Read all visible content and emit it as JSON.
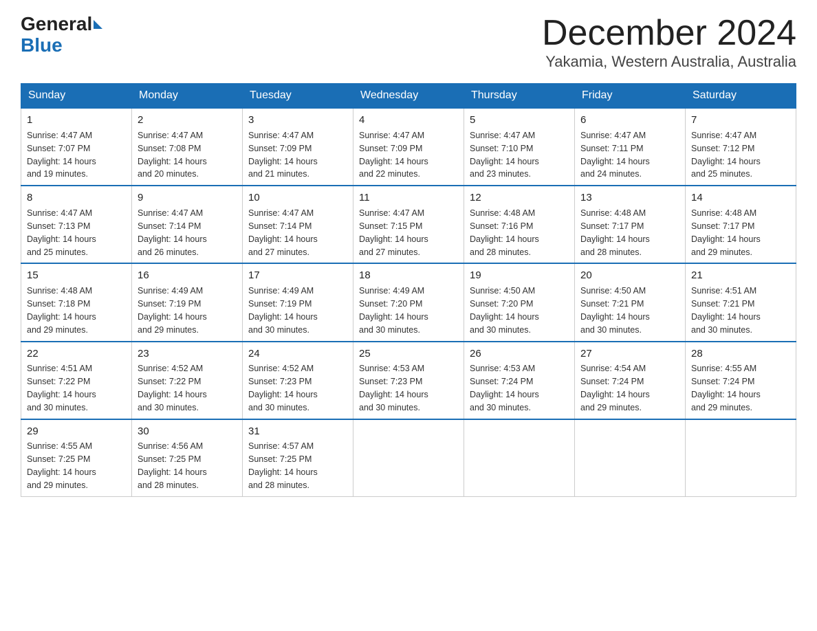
{
  "header": {
    "logo_general": "General",
    "logo_blue": "Blue",
    "title": "December 2024",
    "subtitle": "Yakamia, Western Australia, Australia"
  },
  "days_of_week": [
    "Sunday",
    "Monday",
    "Tuesday",
    "Wednesday",
    "Thursday",
    "Friday",
    "Saturday"
  ],
  "weeks": [
    [
      {
        "day": "1",
        "sunrise": "4:47 AM",
        "sunset": "7:07 PM",
        "daylight": "14 hours and 19 minutes."
      },
      {
        "day": "2",
        "sunrise": "4:47 AM",
        "sunset": "7:08 PM",
        "daylight": "14 hours and 20 minutes."
      },
      {
        "day": "3",
        "sunrise": "4:47 AM",
        "sunset": "7:09 PM",
        "daylight": "14 hours and 21 minutes."
      },
      {
        "day": "4",
        "sunrise": "4:47 AM",
        "sunset": "7:09 PM",
        "daylight": "14 hours and 22 minutes."
      },
      {
        "day": "5",
        "sunrise": "4:47 AM",
        "sunset": "7:10 PM",
        "daylight": "14 hours and 23 minutes."
      },
      {
        "day": "6",
        "sunrise": "4:47 AM",
        "sunset": "7:11 PM",
        "daylight": "14 hours and 24 minutes."
      },
      {
        "day": "7",
        "sunrise": "4:47 AM",
        "sunset": "7:12 PM",
        "daylight": "14 hours and 25 minutes."
      }
    ],
    [
      {
        "day": "8",
        "sunrise": "4:47 AM",
        "sunset": "7:13 PM",
        "daylight": "14 hours and 25 minutes."
      },
      {
        "day": "9",
        "sunrise": "4:47 AM",
        "sunset": "7:14 PM",
        "daylight": "14 hours and 26 minutes."
      },
      {
        "day": "10",
        "sunrise": "4:47 AM",
        "sunset": "7:14 PM",
        "daylight": "14 hours and 27 minutes."
      },
      {
        "day": "11",
        "sunrise": "4:47 AM",
        "sunset": "7:15 PM",
        "daylight": "14 hours and 27 minutes."
      },
      {
        "day": "12",
        "sunrise": "4:48 AM",
        "sunset": "7:16 PM",
        "daylight": "14 hours and 28 minutes."
      },
      {
        "day": "13",
        "sunrise": "4:48 AM",
        "sunset": "7:17 PM",
        "daylight": "14 hours and 28 minutes."
      },
      {
        "day": "14",
        "sunrise": "4:48 AM",
        "sunset": "7:17 PM",
        "daylight": "14 hours and 29 minutes."
      }
    ],
    [
      {
        "day": "15",
        "sunrise": "4:48 AM",
        "sunset": "7:18 PM",
        "daylight": "14 hours and 29 minutes."
      },
      {
        "day": "16",
        "sunrise": "4:49 AM",
        "sunset": "7:19 PM",
        "daylight": "14 hours and 29 minutes."
      },
      {
        "day": "17",
        "sunrise": "4:49 AM",
        "sunset": "7:19 PM",
        "daylight": "14 hours and 30 minutes."
      },
      {
        "day": "18",
        "sunrise": "4:49 AM",
        "sunset": "7:20 PM",
        "daylight": "14 hours and 30 minutes."
      },
      {
        "day": "19",
        "sunrise": "4:50 AM",
        "sunset": "7:20 PM",
        "daylight": "14 hours and 30 minutes."
      },
      {
        "day": "20",
        "sunrise": "4:50 AM",
        "sunset": "7:21 PM",
        "daylight": "14 hours and 30 minutes."
      },
      {
        "day": "21",
        "sunrise": "4:51 AM",
        "sunset": "7:21 PM",
        "daylight": "14 hours and 30 minutes."
      }
    ],
    [
      {
        "day": "22",
        "sunrise": "4:51 AM",
        "sunset": "7:22 PM",
        "daylight": "14 hours and 30 minutes."
      },
      {
        "day": "23",
        "sunrise": "4:52 AM",
        "sunset": "7:22 PM",
        "daylight": "14 hours and 30 minutes."
      },
      {
        "day": "24",
        "sunrise": "4:52 AM",
        "sunset": "7:23 PM",
        "daylight": "14 hours and 30 minutes."
      },
      {
        "day": "25",
        "sunrise": "4:53 AM",
        "sunset": "7:23 PM",
        "daylight": "14 hours and 30 minutes."
      },
      {
        "day": "26",
        "sunrise": "4:53 AM",
        "sunset": "7:24 PM",
        "daylight": "14 hours and 30 minutes."
      },
      {
        "day": "27",
        "sunrise": "4:54 AM",
        "sunset": "7:24 PM",
        "daylight": "14 hours and 29 minutes."
      },
      {
        "day": "28",
        "sunrise": "4:55 AM",
        "sunset": "7:24 PM",
        "daylight": "14 hours and 29 minutes."
      }
    ],
    [
      {
        "day": "29",
        "sunrise": "4:55 AM",
        "sunset": "7:25 PM",
        "daylight": "14 hours and 29 minutes."
      },
      {
        "day": "30",
        "sunrise": "4:56 AM",
        "sunset": "7:25 PM",
        "daylight": "14 hours and 28 minutes."
      },
      {
        "day": "31",
        "sunrise": "4:57 AM",
        "sunset": "7:25 PM",
        "daylight": "14 hours and 28 minutes."
      },
      null,
      null,
      null,
      null
    ]
  ],
  "labels": {
    "sunrise": "Sunrise:",
    "sunset": "Sunset:",
    "daylight": "Daylight:"
  }
}
